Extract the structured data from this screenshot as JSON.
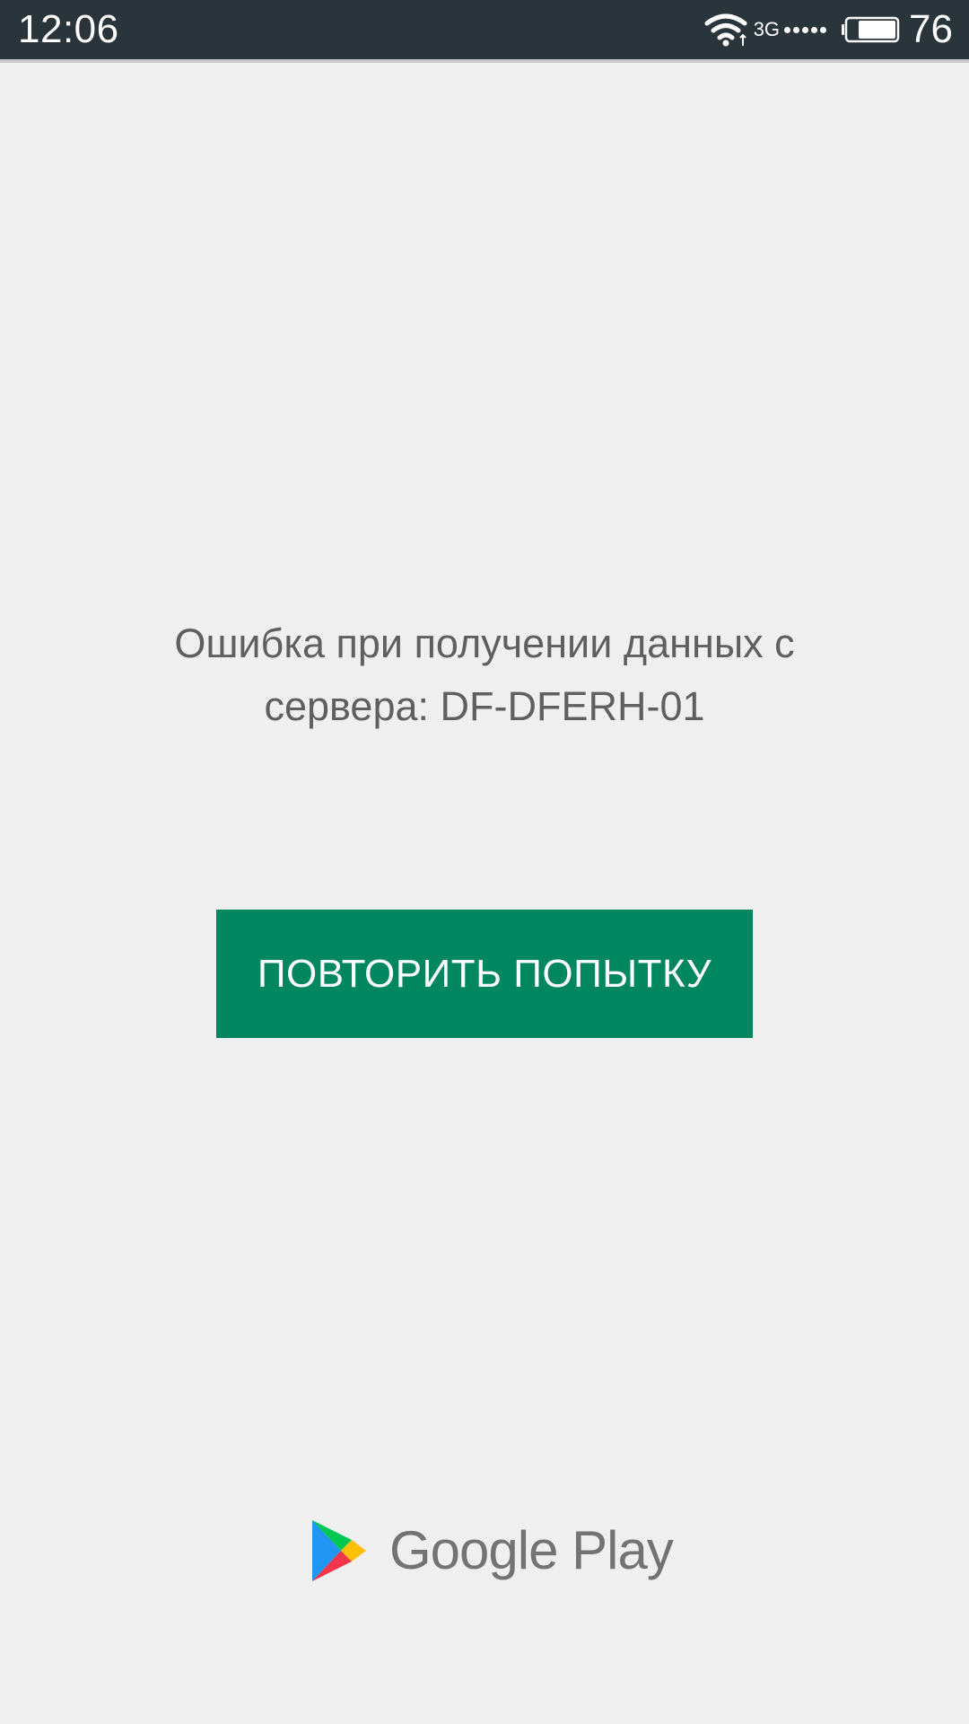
{
  "status_bar": {
    "time": "12:06",
    "network_type": "3G",
    "battery_level": "76",
    "icons": [
      "wifi-icon",
      "signal-dots",
      "battery-icon"
    ]
  },
  "error": {
    "message": "Ошибка при получении данных с сервера: DF-DFERH-01"
  },
  "retry_button": {
    "label": "ПОВТОРИТЬ ПОПЫТКУ"
  },
  "footer": {
    "logo_text": "Google Play",
    "logo_icon": "google-play-icon"
  },
  "colors": {
    "status_bar_bg": "#2a343b",
    "background": "#efefef",
    "button_bg": "#01875f",
    "message_text": "#5f5f5f"
  }
}
